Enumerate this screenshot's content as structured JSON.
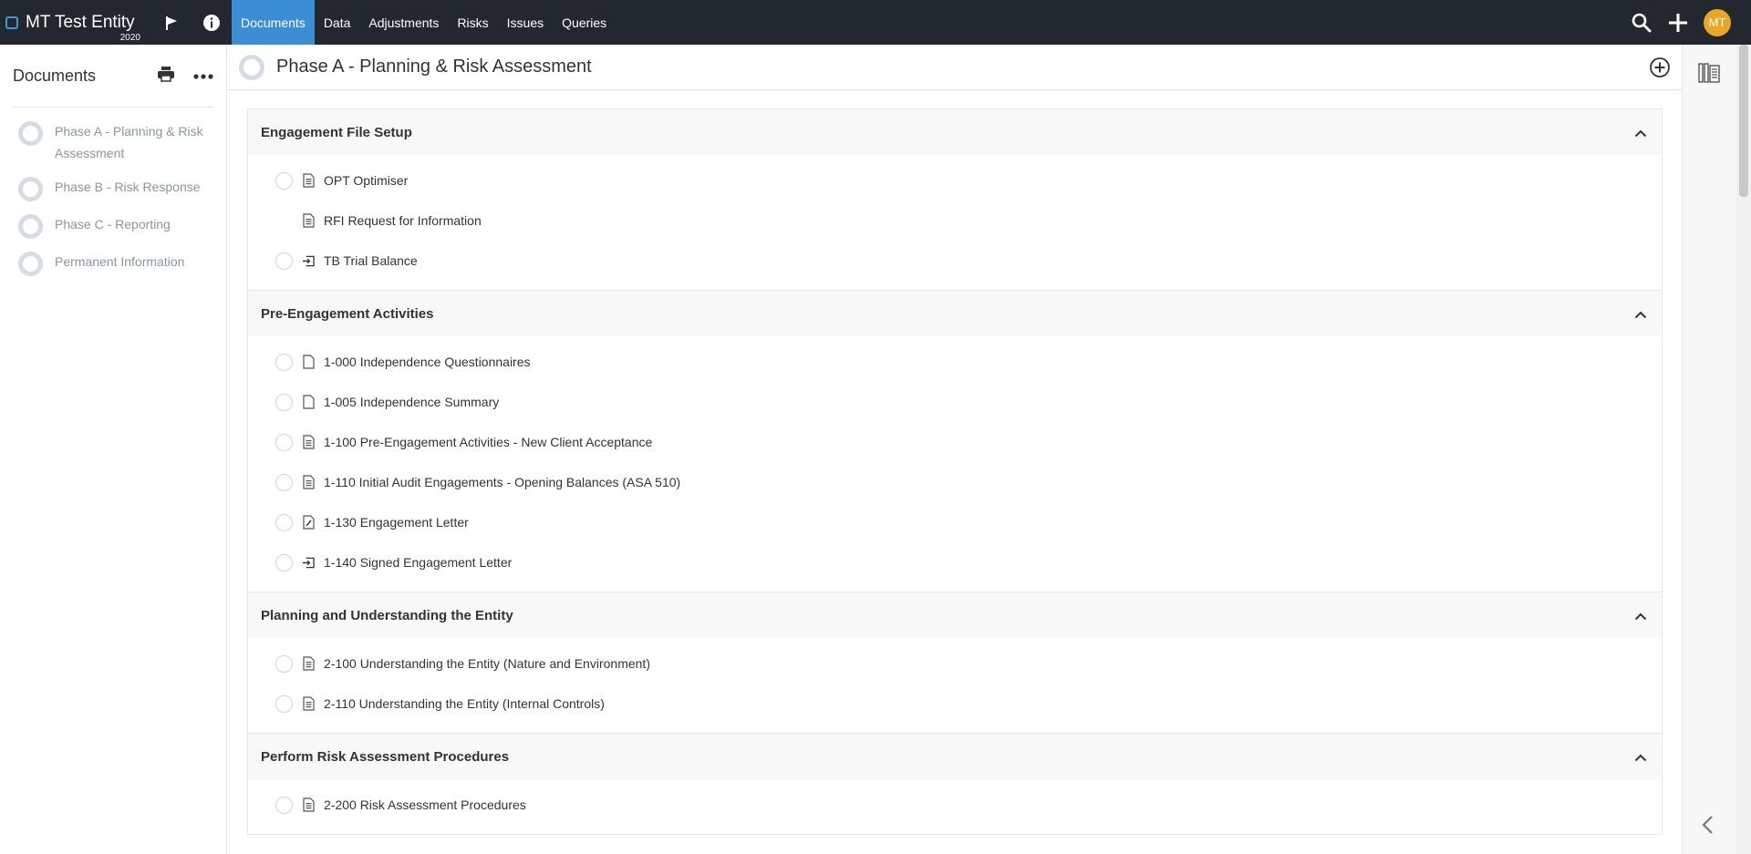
{
  "topbar": {
    "entity_name": "MT Test Entity",
    "entity_year": "2020",
    "nav": [
      {
        "label": "Documents",
        "active": true
      },
      {
        "label": "Data"
      },
      {
        "label": "Adjustments"
      },
      {
        "label": "Risks"
      },
      {
        "label": "Issues"
      },
      {
        "label": "Queries"
      }
    ],
    "avatar_initials": "MT",
    "colors": {
      "bar": "#23272e",
      "active_tab": "#3b8ed6",
      "avatar": "#e9a824"
    },
    "icons": [
      "flag-icon",
      "info-icon",
      "search-icon",
      "plus-icon"
    ]
  },
  "sidebar": {
    "title": "Documents",
    "icons": [
      "print-icon",
      "more-icon"
    ],
    "items": [
      {
        "label": "Phase A - Planning & Risk Assessment"
      },
      {
        "label": "Phase B - Risk Response"
      },
      {
        "label": "Phase C - Reporting"
      },
      {
        "label": "Permanent Information"
      }
    ]
  },
  "main": {
    "title": "Phase A - Planning & Risk Assessment",
    "sections": [
      {
        "title": "Engagement File Setup",
        "docs": [
          {
            "label": "OPT Optimiser",
            "icon": "form-icon",
            "status": true
          },
          {
            "label": "RFI Request for Information",
            "icon": "form-icon",
            "status": false
          },
          {
            "label": "TB Trial Balance",
            "icon": "import-icon",
            "status": true
          }
        ]
      },
      {
        "title": "Pre-Engagement Activities",
        "docs": [
          {
            "label": "1-000 Independence Questionnaires",
            "icon": "document-icon",
            "status": true
          },
          {
            "label": "1-005 Independence Summary",
            "icon": "document-icon",
            "status": true
          },
          {
            "label": "1-100 Pre-Engagement Activities - New Client Acceptance",
            "icon": "form-icon",
            "status": true
          },
          {
            "label": "1-110 Initial Audit Engagements - Opening Balances (ASA 510)",
            "icon": "form-icon",
            "status": true
          },
          {
            "label": "1-130 Engagement Letter",
            "icon": "edit-document-icon",
            "status": true
          },
          {
            "label": "1-140 Signed Engagement Letter",
            "icon": "import-icon",
            "status": true
          }
        ]
      },
      {
        "title": "Planning and Understanding the Entity",
        "docs": [
          {
            "label": "2-100 Understanding the Entity (Nature and Environment)",
            "icon": "form-icon",
            "status": true
          },
          {
            "label": "2-110 Understanding the Entity (Internal Controls)",
            "icon": "form-icon",
            "status": true
          }
        ]
      },
      {
        "title": "Perform Risk Assessment Procedures",
        "docs": [
          {
            "label": "2-200 Risk Assessment Procedures",
            "icon": "form-icon",
            "status": true
          }
        ]
      }
    ]
  },
  "right_panel": {
    "icons": [
      "library-icon",
      "collapse-left-icon"
    ]
  }
}
